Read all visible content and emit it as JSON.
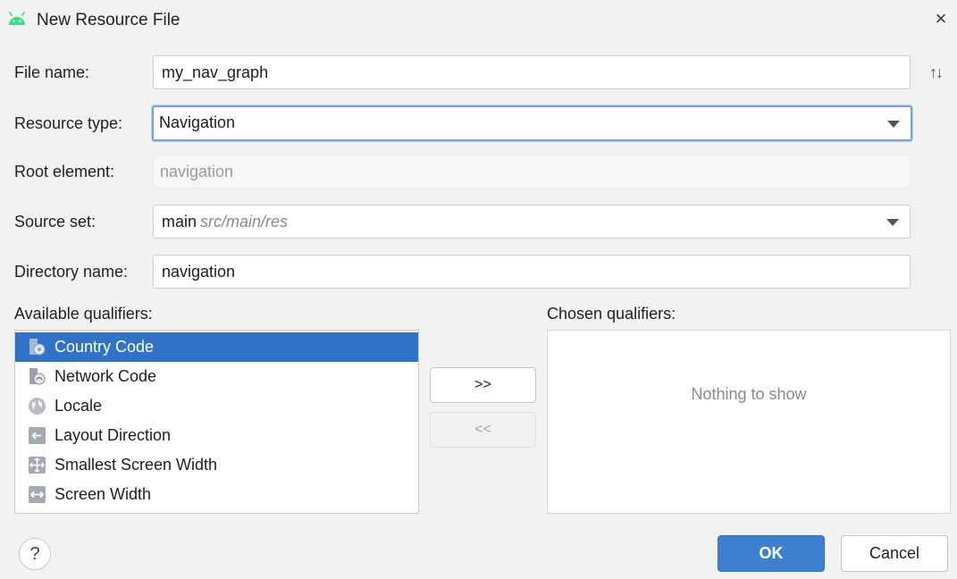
{
  "window": {
    "title": "New Resource File",
    "app_icon": "android-icon",
    "close_glyph": "×"
  },
  "form": {
    "file_name": {
      "label": "File name:",
      "value": "my_nav_graph"
    },
    "resource_type": {
      "label": "Resource type:",
      "value": "Navigation"
    },
    "root_element": {
      "label": "Root element:",
      "value": "navigation"
    },
    "source_set": {
      "label": "Source set:",
      "value": "main",
      "path": "src/main/res"
    },
    "directory_name": {
      "label": "Directory name:",
      "value": "navigation"
    },
    "sort_glyph": "↑↓"
  },
  "available_qualifiers": {
    "label": "Available qualifiers:",
    "items": [
      {
        "label": "Country Code",
        "icon": "country-code-icon",
        "selected": true
      },
      {
        "label": "Network Code",
        "icon": "network-code-icon",
        "selected": false
      },
      {
        "label": "Locale",
        "icon": "globe-icon",
        "selected": false
      },
      {
        "label": "Layout Direction",
        "icon": "layout-direction-icon",
        "selected": false
      },
      {
        "label": "Smallest Screen Width",
        "icon": "smallest-screen-width-icon",
        "selected": false
      },
      {
        "label": "Screen Width",
        "icon": "screen-width-icon",
        "selected": false
      }
    ]
  },
  "transfer": {
    "add_label": ">>",
    "remove_label": "<<"
  },
  "chosen_qualifiers": {
    "label": "Chosen qualifiers:",
    "empty_text": "Nothing to show"
  },
  "footer": {
    "help_glyph": "?",
    "ok_label": "OK",
    "cancel_label": "Cancel"
  },
  "colors": {
    "selection": "#2f72c7",
    "primary_button": "#3d7fd1",
    "focus_border": "#6fa3e4",
    "android_green": "#3ddc84"
  }
}
